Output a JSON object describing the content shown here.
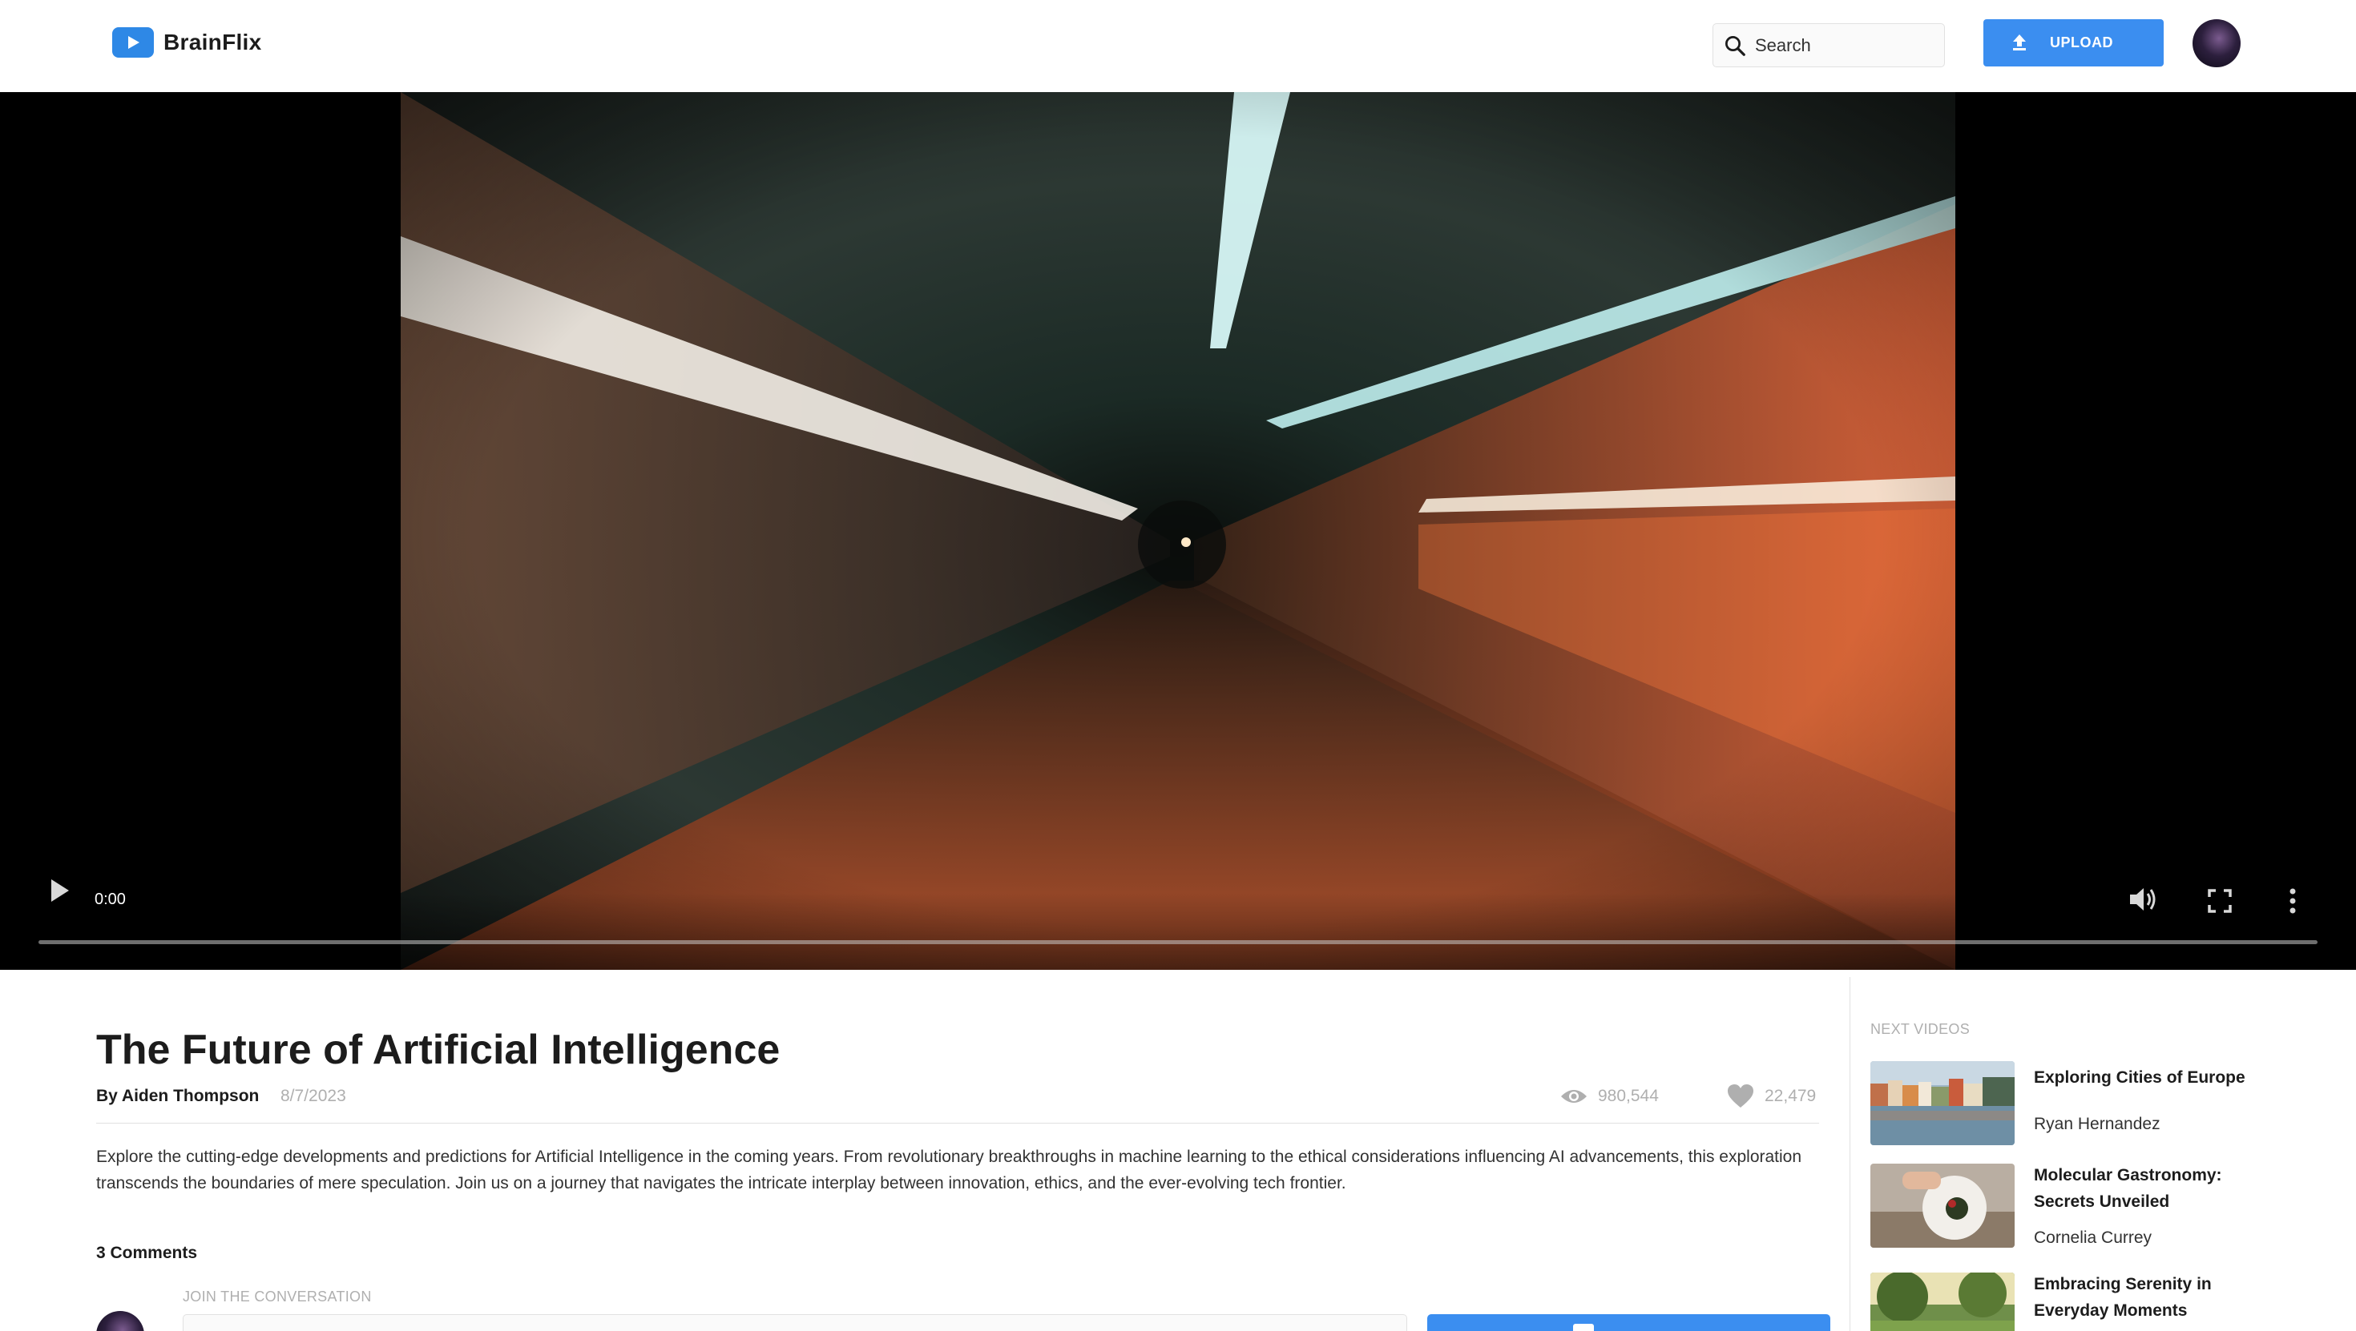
{
  "app": {
    "name": "BrainFlix"
  },
  "header": {
    "search_placeholder": "Search",
    "upload_label": "UPLOAD"
  },
  "player": {
    "current_time": "0:00",
    "progress": 0
  },
  "video": {
    "title": "The Future of Artificial Intelligence",
    "author": "By Aiden Thompson",
    "date": "8/7/2023",
    "views": "980,544",
    "likes": "22,479",
    "description": "Explore the cutting-edge developments and predictions for Artificial Intelligence in the coming years. From revolutionary breakthroughs in machine learning to the ethical considerations influencing AI advancements, this exploration transcends the boundaries of mere speculation. Join us on a journey that navigates the intricate interplay between innovation, ethics, and the ever-evolving tech frontier."
  },
  "comments": {
    "count_label": "3 Comments",
    "join_label": "JOIN THE CONVERSATION"
  },
  "next_videos": {
    "label": "NEXT VIDEOS",
    "items": [
      {
        "title": "Exploring Cities of Europe",
        "author": "Ryan Hernandez"
      },
      {
        "title": "Molecular Gastronomy: Secrets Unveiled",
        "author": "Cornelia Currey"
      },
      {
        "title": "Embracing Serenity in Everyday Moments",
        "author": ""
      }
    ]
  },
  "colors": {
    "accent": "#3b8ef0",
    "text_dark": "#1c1c1c",
    "text_muted": "#afafaf",
    "border": "#e1e1e1"
  }
}
